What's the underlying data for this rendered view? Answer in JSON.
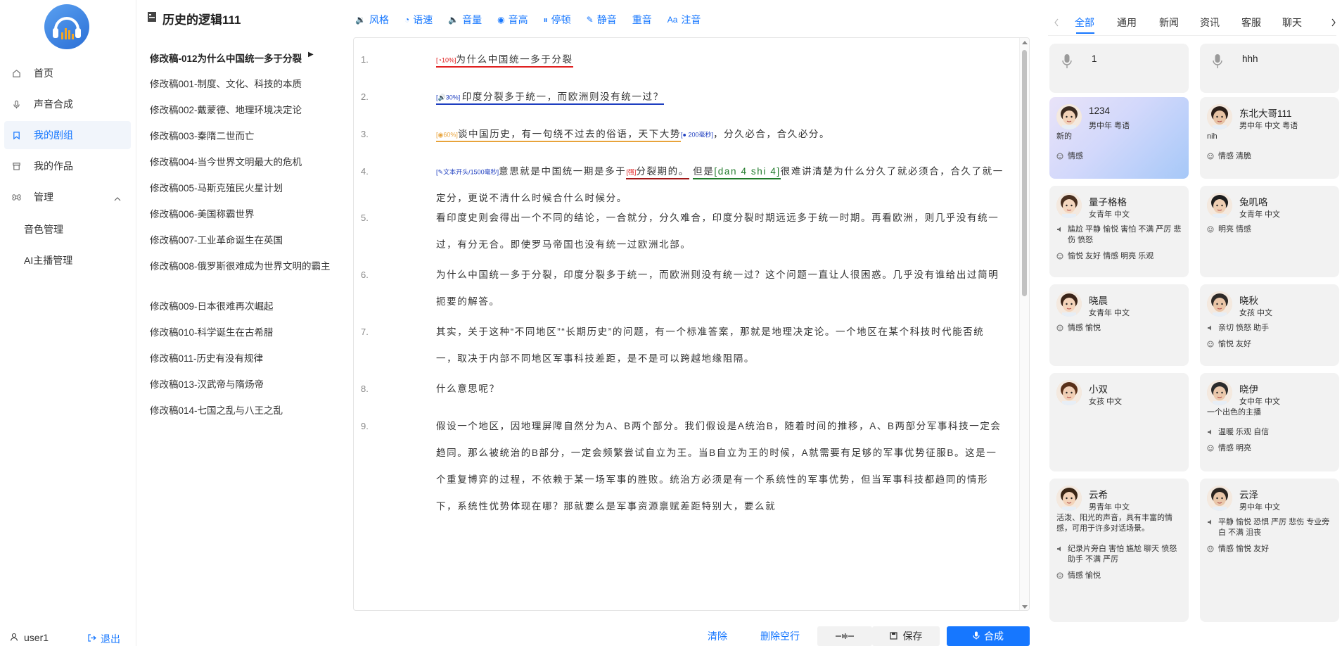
{
  "nav": {
    "items": [
      {
        "label": "首页",
        "icon": "home-icon"
      },
      {
        "label": "声音合成",
        "icon": "mic-icon"
      },
      {
        "label": "我的剧组",
        "icon": "book-icon"
      },
      {
        "label": "我的作品",
        "icon": "archive-icon"
      },
      {
        "label": "管理",
        "icon": "command-icon"
      }
    ],
    "sub_items": [
      "音色管理",
      "AI主播管理"
    ],
    "user": "user1",
    "logout": "退出"
  },
  "project": {
    "title": "历史的逻辑111",
    "docs": [
      "修改稿-012为什么中国统一多于分裂",
      "修改稿001-制度、文化、科技的本质",
      "修改稿002-戴蒙德、地理环境决定论",
      "修改稿003-秦隋二世而亡",
      "修改稿004-当今世界文明最大的危机",
      "修改稿005-马斯克殖民火星计划",
      "修改稿006-美国称霸世界",
      "修改稿007-工业革命诞生在英国",
      "修改稿008-俄罗斯很难成为世界文明的霸主",
      "修改稿009-日本很难再次崛起",
      "修改稿010-科学诞生在古希腊",
      "修改稿011-历史有没有规律",
      "修改稿013-汉武帝与隋炀帝",
      "修改稿014-七国之乱与八王之乱"
    ]
  },
  "toolbar": [
    "风格",
    "语速",
    "音量",
    "音高",
    "停顿",
    "静音",
    "重音",
    "注音"
  ],
  "editor": {
    "lines": [
      {
        "num": "1.",
        "tag": "10%",
        "text": "为什么中国统一多于分裂"
      },
      {
        "num": "2.",
        "tag": "30%",
        "text": "印度分裂多于统一，而欧洲则没有统一过？"
      },
      {
        "num": "3.",
        "tag": "60%",
        "text_a": "谈中国历史，有一句绕不过去的俗语，天下大势",
        "tag2": "200毫秒",
        "text_b": "，分久必合，合久必分。"
      },
      {
        "num": "4.",
        "tag": "文本开头/1500毫秒",
        "text_a": "意思就是中国统一期是多于",
        "tag2": "强",
        "text_b": "分裂期的。",
        "text_c": "但是",
        "pinyin": "[dan 4 shi 4]",
        "text_d": "很难讲清楚为什么分久了就必须合，合久了就一定分，更说不清什么时候合什么时候分。"
      },
      {
        "num": "5.",
        "text": "看印度史则会得出一个不同的结论，一合就分，分久难合，印度分裂时期远远多于统一时期。再看欧洲，则几乎没有统一过，有分无合。即使罗马帝国也没有统一过欧洲北部。"
      },
      {
        "num": "6.",
        "text": "为什么中国统一多于分裂，印度分裂多于统一，而欧洲则没有统一过？这个问题一直让人很困惑。几乎没有谁给出过简明扼要的解答。"
      },
      {
        "num": "7.",
        "text": "其实，关于这种“不同地区”“长期历史”的问题，有一个标准答案，那就是地理决定论。一个地区在某个科技时代能否统一，取决于内部不同地区军事科技差距，是不是可以跨越地缘阻隔。"
      },
      {
        "num": "8.",
        "text": "什么意思呢？"
      },
      {
        "num": "9.",
        "text": "假设一个地区，因地理屏障自然分为A、B两个部分。我们假设是A统治B，随着时间的推移，A、B两部分军事科技一定会趋同。那么被统治的B部分，一定会频繁尝试自立为王。当B自立为王的时候，A就需要有足够的军事优势征服B。这是一个重复博弈的过程，不依赖于某一场军事的胜败。统治方必须是有一个系统性的军事优势，但当军事科技都趋同的情形下，系统性优势体现在哪？那就要么是军事资源禀赋差距特别大，要么就"
      }
    ]
  },
  "actions": {
    "clear": "清除",
    "delete_blank": "删除空行",
    "save": "保存",
    "synth": "合成"
  },
  "voice_tabs": [
    "全部",
    "通用",
    "新闻",
    "资讯",
    "客服",
    "聊天"
  ],
  "voices": [
    {
      "name": "1"
    },
    {
      "name": "hhh"
    },
    {
      "name": "1234",
      "meta": "男中年   粤语",
      "desc": "新的",
      "rows": [
        {
          "icon": "emotion-icon",
          "text": "情感"
        }
      ]
    },
    {
      "name": "东北大哥111",
      "meta": "男中年   中文 粤语",
      "desc": "nih",
      "rows": [
        {
          "icon": "emotion-icon",
          "text": "情感 清脆"
        }
      ]
    },
    {
      "name": "量子格格",
      "meta": "女青年   中文",
      "rows": [
        {
          "icon": "voice-icon",
          "text": "尴尬 平静 愉悦 害怕 不满 严厉 悲伤 愤怒"
        },
        {
          "icon": "emotion-icon",
          "text": "愉悦 友好 情感 明亮 乐观"
        }
      ]
    },
    {
      "name": "兔叽咯",
      "meta": "女青年   中文",
      "rows": [
        {
          "icon": "emotion-icon",
          "text": "明亮 情感"
        }
      ]
    },
    {
      "name": "晓晨",
      "meta": "女青年   中文",
      "rows": [
        {
          "icon": "emotion-icon",
          "text": "情感 愉悦"
        }
      ]
    },
    {
      "name": "晓秋",
      "meta": "女孩   中文",
      "rows": [
        {
          "icon": "voice-icon",
          "text": "亲切 愤怒 助手"
        },
        {
          "icon": "emotion-icon",
          "text": "愉悦 友好"
        }
      ]
    },
    {
      "name": "小双",
      "meta": "女孩   中文"
    },
    {
      "name": "晓伊",
      "meta": "女中年   中文",
      "desc": "一个出色的主播",
      "rows": [
        {
          "icon": "voice-icon",
          "text": "温暖 乐观 自信"
        },
        {
          "icon": "emotion-icon",
          "text": "情感 明亮"
        }
      ]
    },
    {
      "name": "云希",
      "meta": "男青年   中文",
      "desc": "活泼、阳光的声音，具有丰富的情感，可用于许多对话场景。",
      "rows": [
        {
          "icon": "voice-icon",
          "text": "纪录片旁白 害怕 尴尬 聊天 愤怒 助手 不满 严厉"
        },
        {
          "icon": "emotion-icon",
          "text": "情感 愉悦"
        }
      ]
    },
    {
      "name": "云泽",
      "meta": "男中年   中文",
      "rows": [
        {
          "icon": "voice-icon",
          "text": "平静 愉悦 恐惧 严厉 悲伤 专业旁白 不满 沮丧"
        },
        {
          "icon": "emotion-icon",
          "text": "情感 愉悦 友好"
        }
      ]
    }
  ],
  "colors": {
    "accent": "#1677ff",
    "red": "#e02020",
    "blue": "#1f3fc0",
    "orange": "#e8a33a",
    "green": "#1f7a2a"
  }
}
